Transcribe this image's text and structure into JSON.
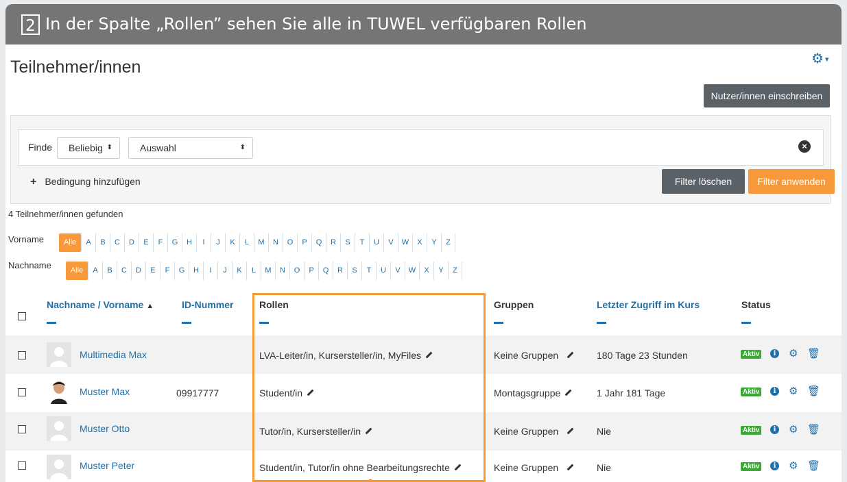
{
  "banner": {
    "number": "2",
    "text": "In der Spalte „Rollen” sehen Sie alle in TUWEL verfügbaren Rollen"
  },
  "page": {
    "title": "Teilnehmer/innen",
    "enroll_button": "Nutzer/innen einschreiben"
  },
  "filter": {
    "label": "Finde",
    "match_value": "Beliebig",
    "select_value": "Auswahl",
    "add_condition": "Bedingung hinzufügen",
    "clear_button": "Filter löschen",
    "apply_button": "Filter anwenden"
  },
  "found_text": "4 Teilnehmer/innen gefunden",
  "initials": {
    "firstname_label": "Vorname",
    "lastname_label": "Nachname",
    "all_label": "Alle",
    "letters": [
      "A",
      "B",
      "C",
      "D",
      "E",
      "F",
      "G",
      "H",
      "I",
      "J",
      "K",
      "L",
      "M",
      "N",
      "O",
      "P",
      "Q",
      "R",
      "S",
      "T",
      "U",
      "V",
      "W",
      "X",
      "Y",
      "Z"
    ]
  },
  "table": {
    "headers": {
      "name": "Nachname / Vorname",
      "sort_indicator": "▲",
      "idnumber": "ID-Nummer",
      "roles": "Rollen",
      "groups": "Gruppen",
      "lastaccess": "Letzter Zugriff im Kurs",
      "status": "Status"
    },
    "rows": [
      {
        "name": "Multimedia Max",
        "idnumber": "",
        "roles": "LVA-Leiter/in, Kursersteller/in, MyFiles",
        "groups": "Keine Gruppen",
        "lastaccess": "180 Tage 23 Stunden",
        "status": "Aktiv"
      },
      {
        "name": "Muster Max",
        "idnumber": "09917777",
        "roles": "Student/in",
        "groups": "Montagsgruppe",
        "lastaccess": "1 Jahr 181 Tage",
        "status": "Aktiv"
      },
      {
        "name": "Muster Otto",
        "idnumber": "",
        "roles": "Tutor/in, Kursersteller/in",
        "groups": "Keine Gruppen",
        "lastaccess": "Nie",
        "status": "Aktiv"
      },
      {
        "name": "Muster Peter",
        "idnumber": "",
        "roles": "Student/in, Tutor/in ohne Bearbeitungsrechte",
        "groups": "Keine Gruppen",
        "lastaccess": "Nie",
        "status": "Aktiv"
      }
    ]
  },
  "icons": {
    "settings": "gear-icon",
    "info": "info-icon",
    "delete": "trash-icon",
    "edit": "pencil-icon",
    "close": "close-icon"
  },
  "colors": {
    "link": "#1f6fa8",
    "accent_orange": "#f7993a",
    "active_green": "#3aaa35",
    "banner_gray": "#757575"
  }
}
